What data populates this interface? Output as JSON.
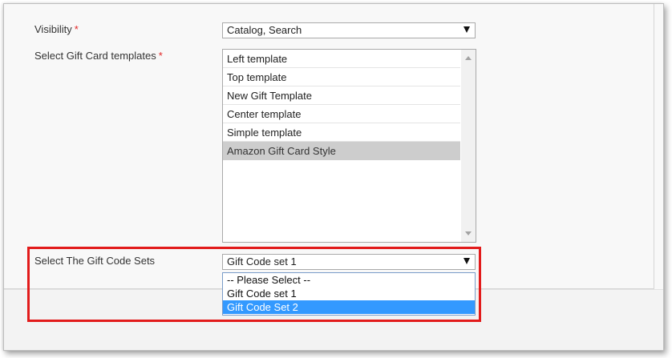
{
  "form": {
    "required_marker": "*",
    "visibility": {
      "label": "Visibility",
      "value": "Catalog, Search"
    },
    "templates": {
      "label": "Select Gift Card templates",
      "items": [
        {
          "label": "Left template",
          "selected": false
        },
        {
          "label": "Top template",
          "selected": false
        },
        {
          "label": "New Gift Template",
          "selected": false
        },
        {
          "label": "Center template",
          "selected": false
        },
        {
          "label": "Simple template",
          "selected": false
        },
        {
          "label": "Amazon Gift Card Style",
          "selected": true
        }
      ]
    },
    "gift_code_sets": {
      "label": "Select The Gift Code Sets",
      "value": "Gift Code set 1",
      "options": [
        {
          "label": "-- Please Select --"
        },
        {
          "label": "Gift Code set 1"
        },
        {
          "label": "Gift Code Set 2",
          "hover": true
        }
      ]
    }
  },
  "colors": {
    "required": "#e22626",
    "highlight_border": "#e21b1b",
    "option_hover": "#3399ff",
    "list_selected": "#cdcdcd"
  }
}
